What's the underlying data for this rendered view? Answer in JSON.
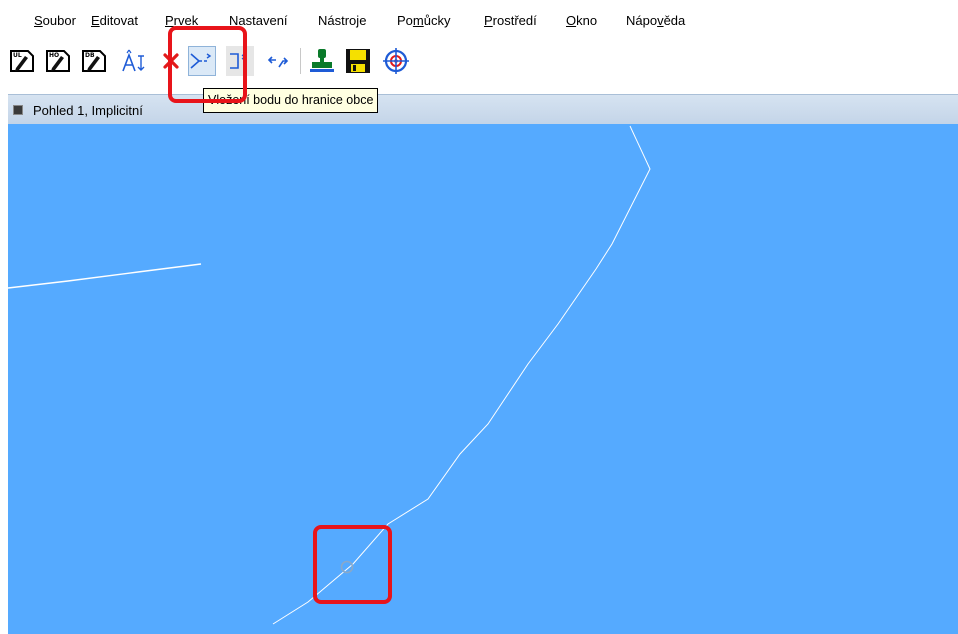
{
  "menu": {
    "items": [
      {
        "acc": "S",
        "rest": "oubor"
      },
      {
        "acc": "E",
        "rest": "ditovat"
      },
      {
        "acc": "P",
        "rest": "rvek"
      },
      {
        "acc": "N",
        "rest": "astavení"
      },
      {
        "pre": "Nástro",
        "acc": "j",
        "rest": "e"
      },
      {
        "pre": "Po",
        "acc": "m",
        "rest": "ůcky"
      },
      {
        "acc": "P",
        "rest": "rostředí"
      },
      {
        "acc": "O",
        "rest": "kno"
      },
      {
        "pre": "Nápo",
        "acc": "v",
        "rest": "ěda"
      }
    ]
  },
  "toolbar": {
    "buttons": [
      {
        "icon": "edit-ul-icon",
        "tag": "UL"
      },
      {
        "icon": "edit-ho-icon",
        "tag": "HO"
      },
      {
        "icon": "edit-db-icon",
        "tag": "DB"
      },
      {
        "icon": "text-insert-icon"
      },
      {
        "icon": "delete-icon"
      },
      {
        "icon": "insert-boundary-point-icon",
        "selected": true
      },
      {
        "icon": "boundary-point-icon",
        "disabled": true
      },
      {
        "icon": "move-arrows-icon"
      },
      {
        "icon": "stamp-icon"
      },
      {
        "icon": "save-icon"
      },
      {
        "icon": "target-icon"
      }
    ]
  },
  "tooltip": {
    "text": "Vložení bodu do hranice obce"
  },
  "view": {
    "title": "Pohled 1, Implicitní"
  },
  "colors": {
    "canvas": "#55aaff",
    "line": "#ffffff",
    "highlight": "#e8141a",
    "tooltip_bg": "#ffffe1"
  }
}
